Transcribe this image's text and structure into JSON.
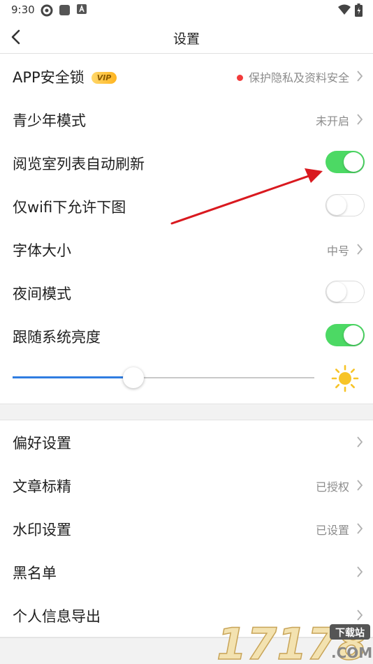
{
  "status_bar": {
    "time": "9:30"
  },
  "nav": {
    "title": "设置"
  },
  "rows": [
    {
      "label": "APP安全锁",
      "badge": "VIP",
      "value": "保护隐私及资料安全"
    },
    {
      "label": "青少年模式",
      "value": "未开启"
    },
    {
      "label": "阅览室列表自动刷新",
      "toggle": "on"
    },
    {
      "label": "仅wifi下允许下图",
      "toggle": "off"
    },
    {
      "label": "字体大小",
      "value": "中号"
    },
    {
      "label": "夜间模式",
      "toggle": "off"
    },
    {
      "label": "跟随系统亮度",
      "toggle": "on"
    }
  ],
  "brightness": {
    "level_fraction": 0.4
  },
  "rows2": [
    {
      "label": "偏好设置",
      "value": ""
    },
    {
      "label": "文章标精",
      "value": "已授权"
    },
    {
      "label": "水印设置",
      "value": "已设置"
    },
    {
      "label": "黑名单",
      "value": ""
    },
    {
      "label": "个人信息导出",
      "value": ""
    }
  ],
  "watermark": {
    "text_main": "17178",
    "text_badge": "下载站",
    "text_com": ".COM"
  },
  "colors": {
    "toggle_on": "#4cd964",
    "slider": "#2f7de1",
    "sun": "#f7c428",
    "arrow": "#d9191f",
    "vip": "#ffb520"
  }
}
